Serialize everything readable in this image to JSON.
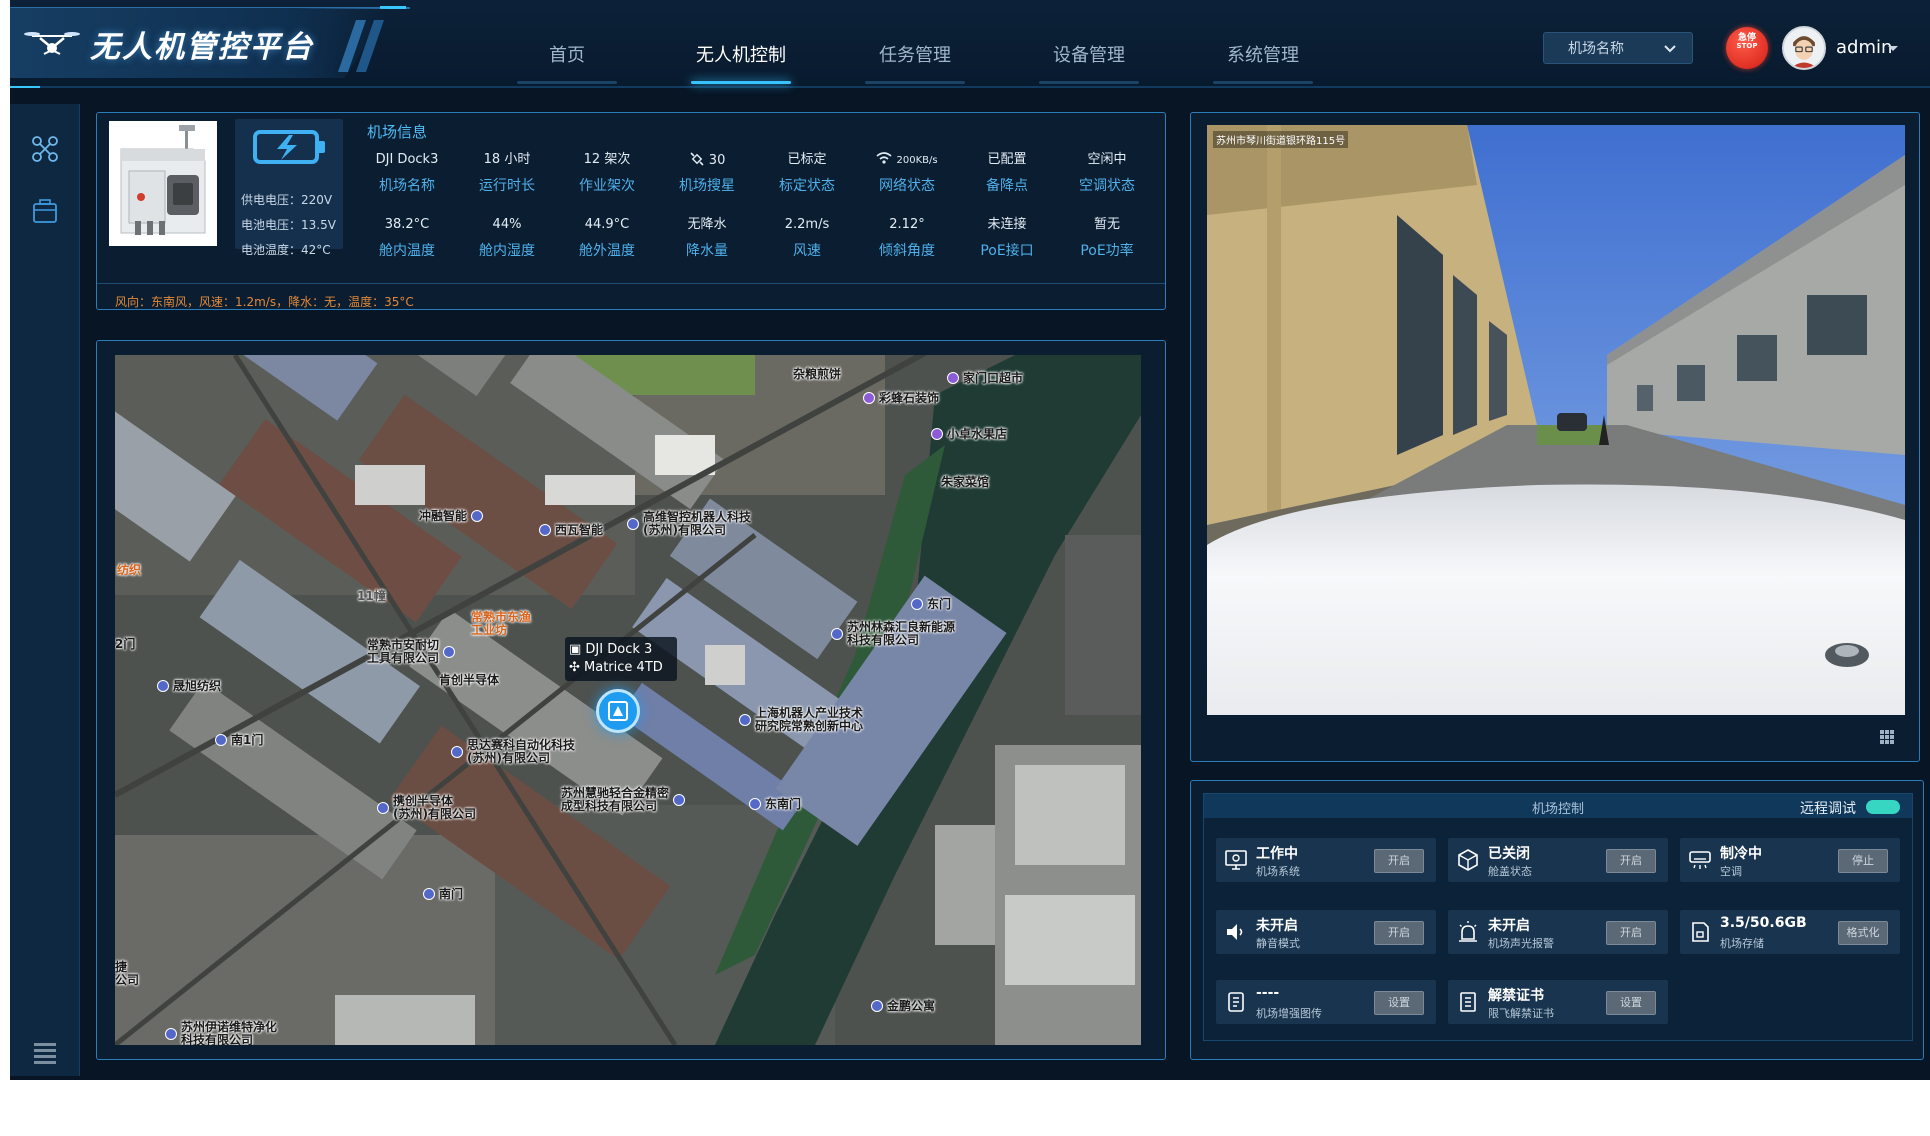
{
  "app": {
    "title": "无人机管控平台"
  },
  "nav": {
    "items": [
      "首页",
      "无人机控制",
      "任务管理",
      "设备管理",
      "系统管理"
    ],
    "active_index": 1
  },
  "header": {
    "site_select": {
      "value": "机场名称"
    },
    "stop_button": {
      "line1": "急停",
      "line2": "STOP"
    },
    "user": {
      "name": "admin"
    }
  },
  "sidebar": {
    "icons": [
      "drone-icon",
      "dock-icon",
      "menu-icon"
    ]
  },
  "dock_info": {
    "battery": {
      "supply_voltage": "供电电压：220V",
      "battery_voltage": "电池电压：13.5V",
      "battery_temp": "电池温度：42°C"
    },
    "title": "机场信息",
    "items": [
      {
        "value": "DJI Dock3",
        "label": "机场名称"
      },
      {
        "value": "18 小时",
        "label": "运行时长"
      },
      {
        "value": "12 架次",
        "label": "作业架次"
      },
      {
        "value": "30",
        "label": "机场搜星",
        "icon": "satellite-icon"
      },
      {
        "value": "已标定",
        "label": "标定状态"
      },
      {
        "value": "200KB/s",
        "label": "网络状态",
        "icon": "wifi-icon"
      },
      {
        "value": "已配置",
        "label": "备降点"
      },
      {
        "value": "空闲中",
        "label": "空调状态"
      },
      {
        "value": "38.2°C",
        "label": "舱内温度"
      },
      {
        "value": "44%",
        "label": "舱内湿度"
      },
      {
        "value": "44.9°C",
        "label": "舱外温度"
      },
      {
        "value": "无降水",
        "label": "降水量"
      },
      {
        "value": "2.2m/s",
        "label": "风速"
      },
      {
        "value": "2.12°",
        "label": "倾斜角度"
      },
      {
        "value": "未连接",
        "label": "PoE接口"
      },
      {
        "value": "暂无",
        "label": "PoE功率"
      }
    ],
    "weather": "风向：东南风，风速：1.2m/s，降水：无，温度：35°C"
  },
  "map": {
    "pois": [
      {
        "name": "杂粮煎饼"
      },
      {
        "name": "家门口超市"
      },
      {
        "name": "彩蜂石装饰"
      },
      {
        "name": "小卓水果店"
      },
      {
        "name": "朱家菜馆"
      },
      {
        "name": "冲融智能"
      },
      {
        "name": "西瓦智能"
      },
      {
        "name": "高维智控机器人科技",
        "line2": "(苏州)有限公司"
      },
      {
        "name": "纺织"
      },
      {
        "name": "11幢"
      },
      {
        "name": "常熟市东渔",
        "line2": "工业坊"
      },
      {
        "name": "东门"
      },
      {
        "name": "苏州林森汇良新能源",
        "line2": "科技有限公司"
      },
      {
        "name": "2门"
      },
      {
        "name": "常熟市安耐切",
        "line2": "工具有限公司"
      },
      {
        "name": "肯创半导体"
      },
      {
        "name": "晟旭纺织"
      },
      {
        "name": "上海机器人产业技术",
        "line2": "研究院常熟创新中心"
      },
      {
        "name": "南1门"
      },
      {
        "name": "思达赛科自动化科技",
        "line2": "(苏州)有限公司"
      },
      {
        "name": "携创半导体",
        "line2": "(苏州)有限公司"
      },
      {
        "name": "苏州慧驰轻合金精密",
        "line2": "成型科技有限公司"
      },
      {
        "name": "东南门"
      },
      {
        "name": "南门"
      },
      {
        "name": "捷",
        "line2": "公司"
      },
      {
        "name": "金鹏公寓"
      },
      {
        "name": "苏州伊诺维特净化",
        "line2": "科技有限公司"
      }
    ],
    "dock_tooltip": {
      "dock": "DJI Dock 3",
      "drone": "Matrice 4TD"
    }
  },
  "camera": {
    "overlay_label": "苏州市琴川街道银环路115号"
  },
  "control": {
    "title": "机场控制",
    "remote_debug_label": "远程调试",
    "remote_debug_on": true,
    "cards": [
      {
        "status": "工作中",
        "name": "机场系统",
        "button": "开启",
        "icon": "system-icon"
      },
      {
        "status": "已关闭",
        "name": "舱盖状态",
        "button": "开启",
        "icon": "cover-icon"
      },
      {
        "status": "制冷中",
        "name": "空调",
        "button": "停止",
        "icon": "ac-icon"
      },
      {
        "status": "未开启",
        "name": "静音模式",
        "button": "开启",
        "icon": "speaker-icon"
      },
      {
        "status": "未开启",
        "name": "机场声光报警",
        "button": "开启",
        "icon": "alarm-icon"
      },
      {
        "status": "3.5/50.6GB",
        "name": "机场存储",
        "button": "格式化",
        "icon": "storage-icon"
      },
      {
        "status": "----",
        "name": "机场增强图传",
        "button": "设置",
        "icon": "transmission-icon"
      },
      {
        "status": "解禁证书",
        "name": "限飞解禁证书",
        "button": "设置",
        "icon": "certificate-icon"
      }
    ]
  },
  "colors": {
    "accent": "#36c3ff",
    "panel_border": "#2a7db8",
    "label_blue": "#4fb0ea",
    "weather_orange": "#e28a3a",
    "stop_red": "#e0271b"
  }
}
